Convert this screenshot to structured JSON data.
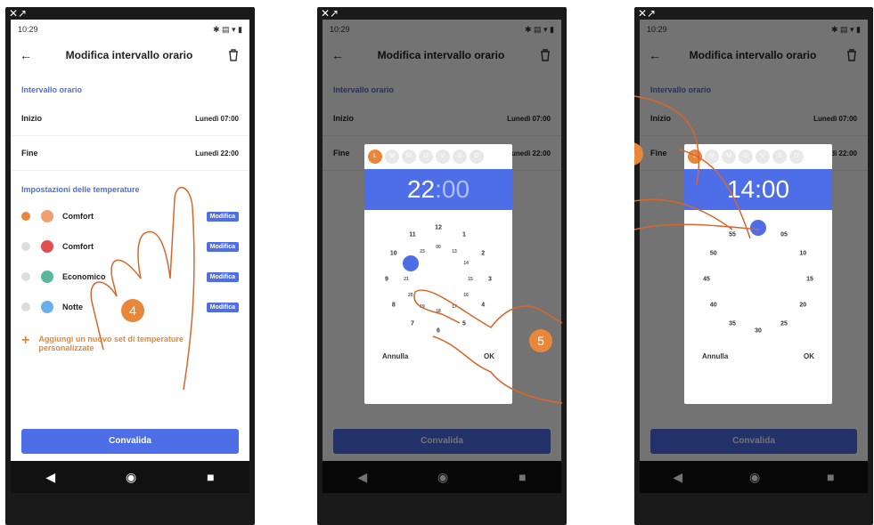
{
  "screen1": {
    "status": {
      "time": "10:29"
    },
    "title": "Modifica intervallo orario",
    "section_interval": "Intervallo orario",
    "start_label": "Inizio",
    "start_value": "Lunedì 07:00",
    "end_label": "Fine",
    "end_value": "Lunedì 22:00",
    "section_temps": "Impostazioni delle temperature",
    "temps": [
      {
        "name": "Comfort",
        "selected": true,
        "color": "#f0a070",
        "btn": "Modifica"
      },
      {
        "name": "Comfort",
        "selected": false,
        "color": "#e05050",
        "btn": "Modifica"
      },
      {
        "name": "Economico",
        "selected": false,
        "color": "#5ab89a",
        "btn": "Modifica"
      },
      {
        "name": "Notte",
        "selected": false,
        "color": "#6ab0e8",
        "btn": "Modifica"
      }
    ],
    "add_text": "Aggiungi un nuovo set di temperature personalizzate",
    "validate": "Convalida",
    "step_badge": "4"
  },
  "screen2": {
    "days": [
      "L",
      "M",
      "M",
      "G",
      "V",
      "S",
      "D"
    ],
    "time_hours": "22",
    "time_minutes": ":00",
    "cancel": "Annulla",
    "ok": "OK",
    "outer_numbers": [
      "12",
      "1",
      "2",
      "3",
      "4",
      "5",
      "6",
      "7",
      "8",
      "9",
      "10",
      "11"
    ],
    "inner_numbers": [
      "00",
      "13",
      "14",
      "15",
      "16",
      "17",
      "18",
      "19",
      "20",
      "21",
      "22",
      "23"
    ],
    "step_badge": "5"
  },
  "screen3": {
    "time_hours": "14",
    "time_minutes": ":00",
    "cancel": "Annulla",
    "ok": "OK",
    "minute_numbers": [
      "00",
      "05",
      "10",
      "15",
      "20",
      "25",
      "30",
      "35",
      "40",
      "45",
      "50",
      "55"
    ],
    "step_badge": "6"
  },
  "colors": {
    "accent": "#4d6ee6",
    "orange": "#e8873a"
  }
}
